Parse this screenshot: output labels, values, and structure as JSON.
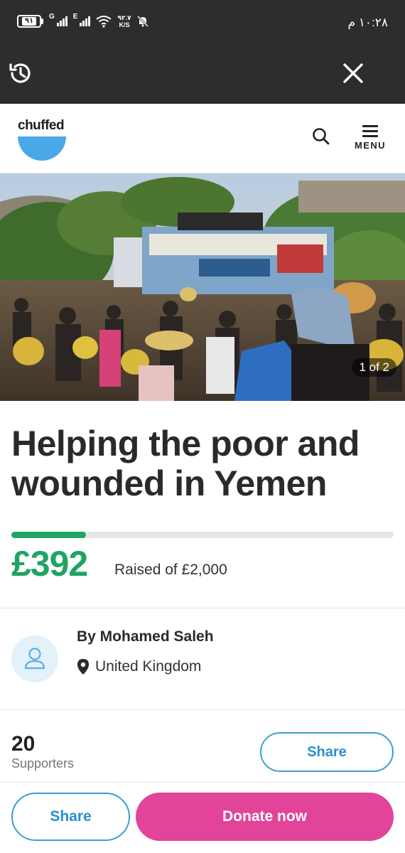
{
  "status_bar": {
    "battery": "٩١",
    "network_1": "G",
    "network_2": "E",
    "speed_value": "٩٢.٧",
    "speed_unit": "K/S",
    "time": "١٠:٢٨ م",
    "icons": [
      "battery-icon",
      "signal-icon",
      "signal-icon",
      "wifi-icon",
      "mute-bell-icon"
    ]
  },
  "browser_bar": {
    "icons": [
      "history-icon",
      "close-icon"
    ]
  },
  "header": {
    "logo_text": "chuffed",
    "menu_label": "MENU",
    "icons": [
      "search-icon",
      "hamburger-icon"
    ]
  },
  "hero": {
    "photo_counter": "1 of 2"
  },
  "campaign": {
    "title": "Helping the poor and wounded in Yemen",
    "raised": "£392",
    "raised_of": "Raised of £2,000",
    "progress_fraction": 0.196
  },
  "organiser": {
    "name": "By Mohamed Saleh",
    "location": "United Kingdom",
    "icons": [
      "user-icon",
      "location-pin-icon"
    ]
  },
  "supporters": {
    "count": "20",
    "label": "Supporters",
    "share_label": "Share"
  },
  "bottom_bar": {
    "share_label": "Share",
    "donate_label": "Donate now"
  },
  "colors": {
    "brand_blue": "#4aa8e8",
    "progress_green": "#1fa463",
    "donate_pink": "#e2449a",
    "share_blue": "#2b8fcf",
    "dark_bar": "#2d2d2d"
  }
}
